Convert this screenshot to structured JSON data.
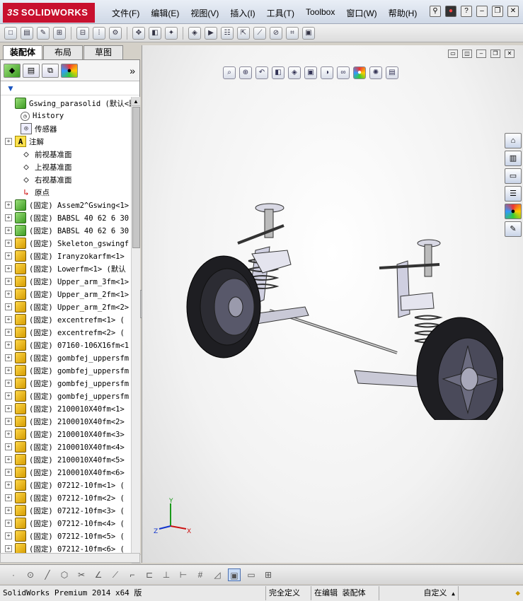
{
  "app": {
    "brand_prefix": "3S",
    "brand": "SOLIDWORKS"
  },
  "menu": [
    "文件(F)",
    "编辑(E)",
    "视图(V)",
    "插入(I)",
    "工具(T)",
    "Toolbox",
    "窗口(W)",
    "帮助(H)"
  ],
  "tabs": [
    "装配体",
    "布局",
    "草图"
  ],
  "tree": {
    "filter_symbol": "▼",
    "root": "Gswing_parasolid  (默认<默",
    "items": [
      {
        "label": "History",
        "icon": "history-icon"
      },
      {
        "label": "传感器",
        "icon": "sensor-icon"
      },
      {
        "label": "注解",
        "icon": "annotation-icon",
        "expandable": true
      },
      {
        "label": "前视基准面",
        "icon": "plane-icon"
      },
      {
        "label": "上视基准面",
        "icon": "plane-icon"
      },
      {
        "label": "右视基准面",
        "icon": "plane-icon"
      },
      {
        "label": "原点",
        "icon": "origin-icon"
      },
      {
        "label": "(固定) Assem2^Gswing<1>",
        "icon": "assembly-icon",
        "expandable": true
      },
      {
        "label": "(固定) BABSL 40 62 6 30",
        "icon": "assembly-icon",
        "expandable": true
      },
      {
        "label": "(固定) BABSL 40 62 6 30",
        "icon": "assembly-icon",
        "expandable": true
      },
      {
        "label": "(固定) Skeleton_gswingf",
        "icon": "part-icon",
        "expandable": true
      },
      {
        "label": "(固定) Iranyzokarfm<1>",
        "icon": "part-icon",
        "expandable": true
      },
      {
        "label": "(固定) Lowerfm<1> (默认",
        "icon": "part-icon",
        "expandable": true
      },
      {
        "label": "(固定) Upper_arm_3fm<1>",
        "icon": "part-icon",
        "expandable": true
      },
      {
        "label": "(固定) Upper_arm_2fm<1>",
        "icon": "part-icon",
        "expandable": true
      },
      {
        "label": "(固定) Upper_arm_2fm<2>",
        "icon": "part-icon",
        "expandable": true
      },
      {
        "label": "(固定) excentrefm<1> (",
        "icon": "part-icon",
        "expandable": true
      },
      {
        "label": "(固定) excentrefm<2> (",
        "icon": "part-icon",
        "expandable": true
      },
      {
        "label": "(固定) 07160-106X16fm<1",
        "icon": "part-icon",
        "expandable": true
      },
      {
        "label": "(固定) gombfej_uppersfm",
        "icon": "part-icon",
        "expandable": true
      },
      {
        "label": "(固定) gombfej_uppersfm",
        "icon": "part-icon",
        "expandable": true
      },
      {
        "label": "(固定) gombfej_uppersfm",
        "icon": "part-icon",
        "expandable": true
      },
      {
        "label": "(固定) gombfej_uppersfm",
        "icon": "part-icon",
        "expandable": true
      },
      {
        "label": "(固定) 2100010X40fm<1>",
        "icon": "part-icon",
        "expandable": true
      },
      {
        "label": "(固定) 2100010X40fm<2>",
        "icon": "part-icon",
        "expandable": true
      },
      {
        "label": "(固定) 2100010X40fm<3>",
        "icon": "part-icon",
        "expandable": true
      },
      {
        "label": "(固定) 2100010X40fm<4>",
        "icon": "part-icon",
        "expandable": true
      },
      {
        "label": "(固定) 2100010X40fm<5>",
        "icon": "part-icon",
        "expandable": true
      },
      {
        "label": "(固定) 2100010X40fm<6>",
        "icon": "part-icon",
        "expandable": true
      },
      {
        "label": "(固定) 07212-10fm<1> (",
        "icon": "part-icon",
        "expandable": true
      },
      {
        "label": "(固定) 07212-10fm<2> (",
        "icon": "part-icon",
        "expandable": true
      },
      {
        "label": "(固定) 07212-10fm<3> (",
        "icon": "part-icon",
        "expandable": true
      },
      {
        "label": "(固定) 07212-10fm<4> (",
        "icon": "part-icon",
        "expandable": true
      },
      {
        "label": "(固定) 07212-10fm<5> (",
        "icon": "part-icon",
        "expandable": true
      },
      {
        "label": "(固定) 07212-10fm<6> (",
        "icon": "part-icon",
        "expandable": true
      }
    ]
  },
  "triad": {
    "x": "X",
    "y": "Y",
    "z": "Z"
  },
  "status": {
    "product": "SolidWorks Premium 2014 x64 版",
    "definition": "完全定义",
    "editing": "在编辑 装配体",
    "custom": "自定义",
    "custom_arrow": "▲"
  },
  "colors": {
    "brand_red": "#c8102e",
    "tree_link": "#1a55c0"
  }
}
